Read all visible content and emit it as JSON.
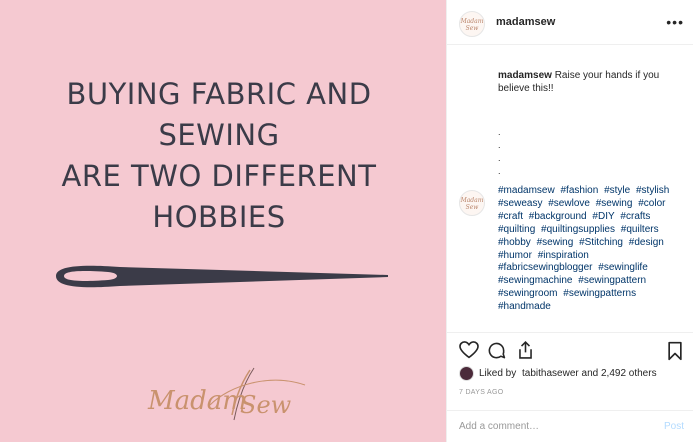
{
  "image": {
    "headline_lines": [
      "BUYING FABRIC AND",
      "SEWING",
      "ARE TWO DIFFERENT",
      "HOBBIES"
    ],
    "logo_text": "Madam Sew",
    "background_color": "#f5c9d1",
    "text_color": "#3b3b48",
    "logo_color": "#c9926e"
  },
  "header": {
    "username": "madamsew",
    "avatar_text": "Madam Sew",
    "more_icon": "more-horizontal-icon"
  },
  "caption": {
    "username": "madamsew",
    "text": "Raise your hands if you believe this!!",
    "dots": [
      ".",
      ".",
      ".",
      "."
    ]
  },
  "hashtag_comment": {
    "avatar_text": "Madam Sew",
    "hashtags": [
      "#madamsew",
      "#fashion",
      "#style",
      "#stylish",
      "#seweasy",
      "#sewlove",
      "#sewing",
      "#color",
      "#craft",
      "#background",
      "#DIY",
      "#crafts",
      "#quilting",
      "#quiltingsupplies",
      "#quilters",
      "#hobby",
      "#sewing",
      "#Stitching",
      "#design",
      "#humor",
      "#inspiration",
      "#fabricsewingblogger",
      "#sewinglife",
      "#sewingmachine",
      "#sewingpattern",
      "#sewingroom",
      "#sewingpatterns",
      "#handmade"
    ]
  },
  "actions": {
    "icons": [
      "heart-icon",
      "comment-icon",
      "share-icon",
      "bookmark-icon"
    ],
    "liked_prefix": "Liked by ",
    "liked_user": "tabithasewer",
    "liked_suffix": " and 2,492 others",
    "timestamp": "7 DAYS AGO"
  },
  "comment_box": {
    "placeholder": "Add a comment…",
    "post_label": "Post"
  },
  "colors": {
    "hashtag": "#003569",
    "muted": "#999999",
    "post_disabled": "#b3dbff"
  }
}
